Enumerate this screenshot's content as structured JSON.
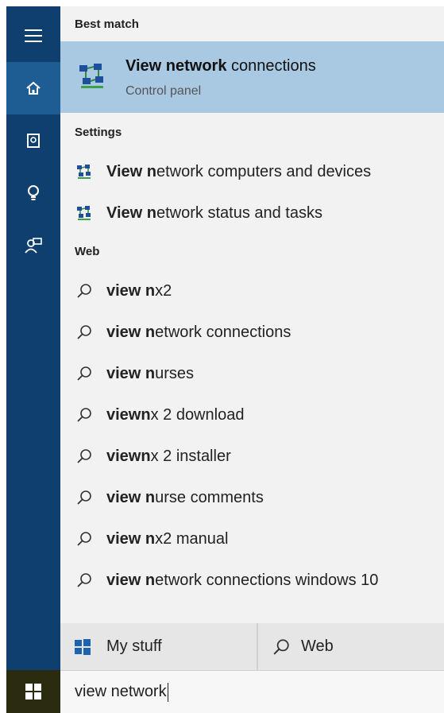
{
  "rail": {
    "items": [
      {
        "icon": "menu-icon"
      },
      {
        "icon": "home-icon"
      },
      {
        "icon": "notebook-icon"
      },
      {
        "icon": "lightbulb-icon"
      },
      {
        "icon": "feedback-icon"
      }
    ],
    "start_icon": "windows-logo-icon"
  },
  "sections": {
    "best_match": "Best match",
    "settings": "Settings",
    "web": "Web"
  },
  "best_match": {
    "title_bold": "View network",
    "title_rest": " connections",
    "subtitle": "Control panel",
    "icon": "network-icon"
  },
  "settings_items": [
    {
      "bold": "View n",
      "rest": "etwork computers and devices",
      "icon": "network-icon"
    },
    {
      "bold": "View n",
      "rest": "etwork status and tasks",
      "icon": "network-icon"
    }
  ],
  "web_items": [
    {
      "bold": "view n",
      "rest": "x2"
    },
    {
      "bold": "view n",
      "rest": "etwork connections"
    },
    {
      "bold": "view n",
      "rest": "urses"
    },
    {
      "bold": "viewn",
      "rest": "x 2 download"
    },
    {
      "bold": "viewn",
      "rest": "x 2 installer"
    },
    {
      "bold": "view n",
      "rest": "urse comments"
    },
    {
      "bold": "view n",
      "rest": "x2 manual"
    },
    {
      "bold": "view n",
      "rest": "etwork connections windows 10"
    }
  ],
  "filters": {
    "my_stuff": "My stuff",
    "web": "Web"
  },
  "search": {
    "value": "view network"
  },
  "colors": {
    "rail": "#0f3f6e",
    "rail_active": "#1e5d93",
    "selection": "#a9c8e2",
    "panel": "#f2f2f2"
  }
}
